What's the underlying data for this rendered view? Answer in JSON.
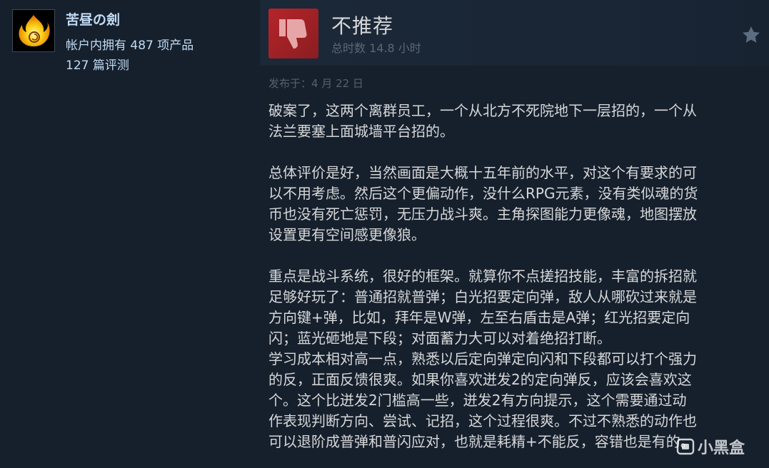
{
  "author": {
    "name": "苦昼の劍",
    "products_owned": "帐户内拥有 487 项产品",
    "reviews_count": "127 篇评测"
  },
  "review": {
    "verdict": "不推荐",
    "hours": "总时数 14.8 小时",
    "posted": "发布于：4 月 22 日",
    "lines": [
      "破案了，这两个离群员工，一个从北方不死院地下一层招的，一个从",
      "法兰要塞上面城墙平台招的。",
      "",
      "总体评价是好，当然画面是大概十五年前的水平，对这个有要求的可",
      "以不用考虑。然后这个更偏动作，没什么RPG元素，没有类似魂的货",
      "币也没有死亡惩罚，无压力战斗爽。主角探图能力更像魂，地图摆放",
      "设置更有空间感更像狼。",
      "",
      "重点是战斗系统，很好的框架。就算你不点搓招技能，丰富的拆招就",
      "足够好玩了：普通招就普弹；白光招要定向弹，敌人从哪砍过来就是",
      "方向键+弹，比如，拜年是W弹，左至右盾击是A弹；红光招要定向",
      "闪；蓝光砸地是下段；对面蓄力大可以对着绝招打断。",
      "学习成本相对高一点，熟悉以后定向弹定向闪和下段都可以打个强力",
      "的反，正面反馈很爽。如果你喜欢迸发2的定向弹反，应该会喜欢这",
      "个。这个比迸发2门槛高一些，迸发2有方向提示，这个需要通过动",
      "作表现判断方向、尝试、记招，这个过程很爽。不过不熟悉的动作也",
      "可以退阶成普弹和普闪应对，也就是耗精+不能反，容错也是有的。"
    ]
  },
  "watermark": {
    "text": "小黑盒"
  },
  "colors": {
    "background": "#16202d",
    "thumb_down": "#b5252a",
    "text_primary": "#d6d7d8",
    "text_link": "#c1dbf4",
    "text_muted": "#5d6773"
  },
  "icons": {
    "avatar": "flame-avatar",
    "vote": "thumbs-down-icon",
    "award": "star-icon",
    "watermark": "heybox-logo-icon"
  }
}
